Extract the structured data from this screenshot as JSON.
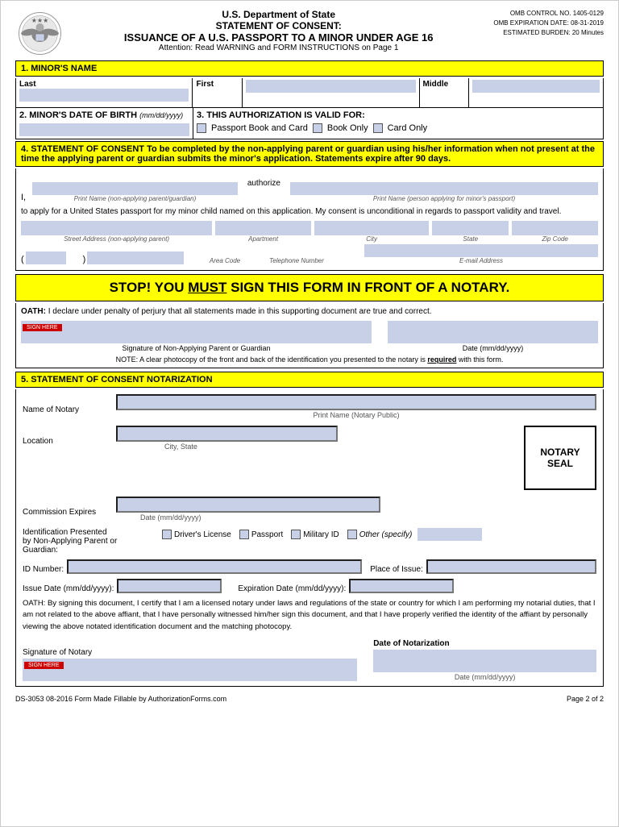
{
  "header": {
    "dept": "U.S. Department of State",
    "statement": "STATEMENT OF CONSENT:",
    "issuance": "ISSUANCE OF A U.S. PASSPORT TO A MINOR UNDER AGE 16",
    "attention": "Attention: Read WARNING and FORM INSTRUCTIONS on Page 1",
    "omb_control": "OMB CONTROL NO. 1405-0129",
    "omb_expiration": "OMB EXPIRATION DATE: 08-31-2019",
    "estimated_burden": "ESTIMATED BURDEN: 20 Minutes"
  },
  "section1": {
    "title": "1. MINOR'S NAME",
    "last_label": "Last",
    "first_label": "First",
    "middle_label": "Middle"
  },
  "section2": {
    "title": "2. MINOR'S DATE OF BIRTH",
    "format": "(mm/dd/yyyy)"
  },
  "section3": {
    "title": "3. THIS AUTHORIZATION IS VALID FOR:",
    "option1": "Passport Book and Card",
    "option2": "Book Only",
    "option3": "Card Only"
  },
  "section4": {
    "title": "4. STATEMENT OF CONSENT",
    "description": "To be completed by the non-applying parent or guardian using his/her information when not present at the time the applying parent or guardian submits the minor's application.",
    "expire_note": "Statements expire after 90 days.",
    "i_label": "I,",
    "authorize_label": "authorize",
    "print_name_1_label": "Print Name (non-applying parent/guardian)",
    "print_name_2_label": "Print Name (person applying for minor's passport)",
    "apply_text": "to apply for a United States passport for my minor child named on this application. My consent is unconditional in regards to passport validity and travel.",
    "street_label": "Street Address (non-applying parent)",
    "apt_label": "Apartment",
    "city_label": "City",
    "state_label": "State",
    "zip_label": "Zip Code",
    "area_code_label": "Area Code",
    "phone_label": "Telephone Number",
    "email_label": "E-mail Address"
  },
  "stop_section": {
    "text": "STOP! YOU MUST SIGN THIS FORM IN FRONT OF A NOTARY."
  },
  "oath_section": {
    "label": "OATH:",
    "text": "I declare under penalty of perjury that all statements made in this supporting document are true and correct.",
    "sig_label": "Signature of Non-Applying Parent or Guardian",
    "date_label": "Date (mm/dd/yyyy)",
    "note": "NOTE: A clear photocopy of the front and back of the identification you presented to the notary is",
    "note_required": "required",
    "note_end": "with this form.",
    "sign_btn": "SIGN HERE"
  },
  "section5": {
    "title": "5. STATEMENT OF CONSENT NOTARIZATION",
    "name_of_notary_label": "Name of Notary",
    "print_name_label": "Print Name (Notary Public)",
    "location_label": "Location",
    "city_state_label": "City,  State",
    "notary_seal_label": "NOTARY\nSEAL",
    "commission_expires_label": "Commission Expires",
    "date_format_label": "Date (mm/dd/yyyy)",
    "id_presented_label": "Identification Presented\nby Non-Applying Parent or\nGuardian:",
    "drivers_license": "Driver's License",
    "passport": "Passport",
    "military_id": "Military ID",
    "other": "Other (specify)",
    "id_number_label": "ID Number:",
    "place_of_issue_label": "Place of Issue:",
    "issue_date_label": "Issue Date (mm/dd/yyyy):",
    "expiration_date_label": "Expiration Date (mm/dd/yyyy):",
    "oath2_text": "OATH: By signing this document, I certify that I am a licensed notary under laws and regulations of the state or country for which I am performing my notarial duties, that I am not related to the above affiant, that I have personally witnessed him/her sign this document, and that I have properly verified the identity of the affiant by personally viewing the above notated identification document and the matching photocopy.",
    "signature_of_notary": "Signature of Notary",
    "date_of_notarization": "Date of Notarization",
    "date_format_label2": "Date (mm/dd/yyyy)",
    "sign_btn": "SIGN HERE"
  },
  "footer": {
    "form_id": "DS-3053   08-2016   Form Made Fillable by AuthorizationForms.com",
    "page": "Page 2 of 2"
  }
}
